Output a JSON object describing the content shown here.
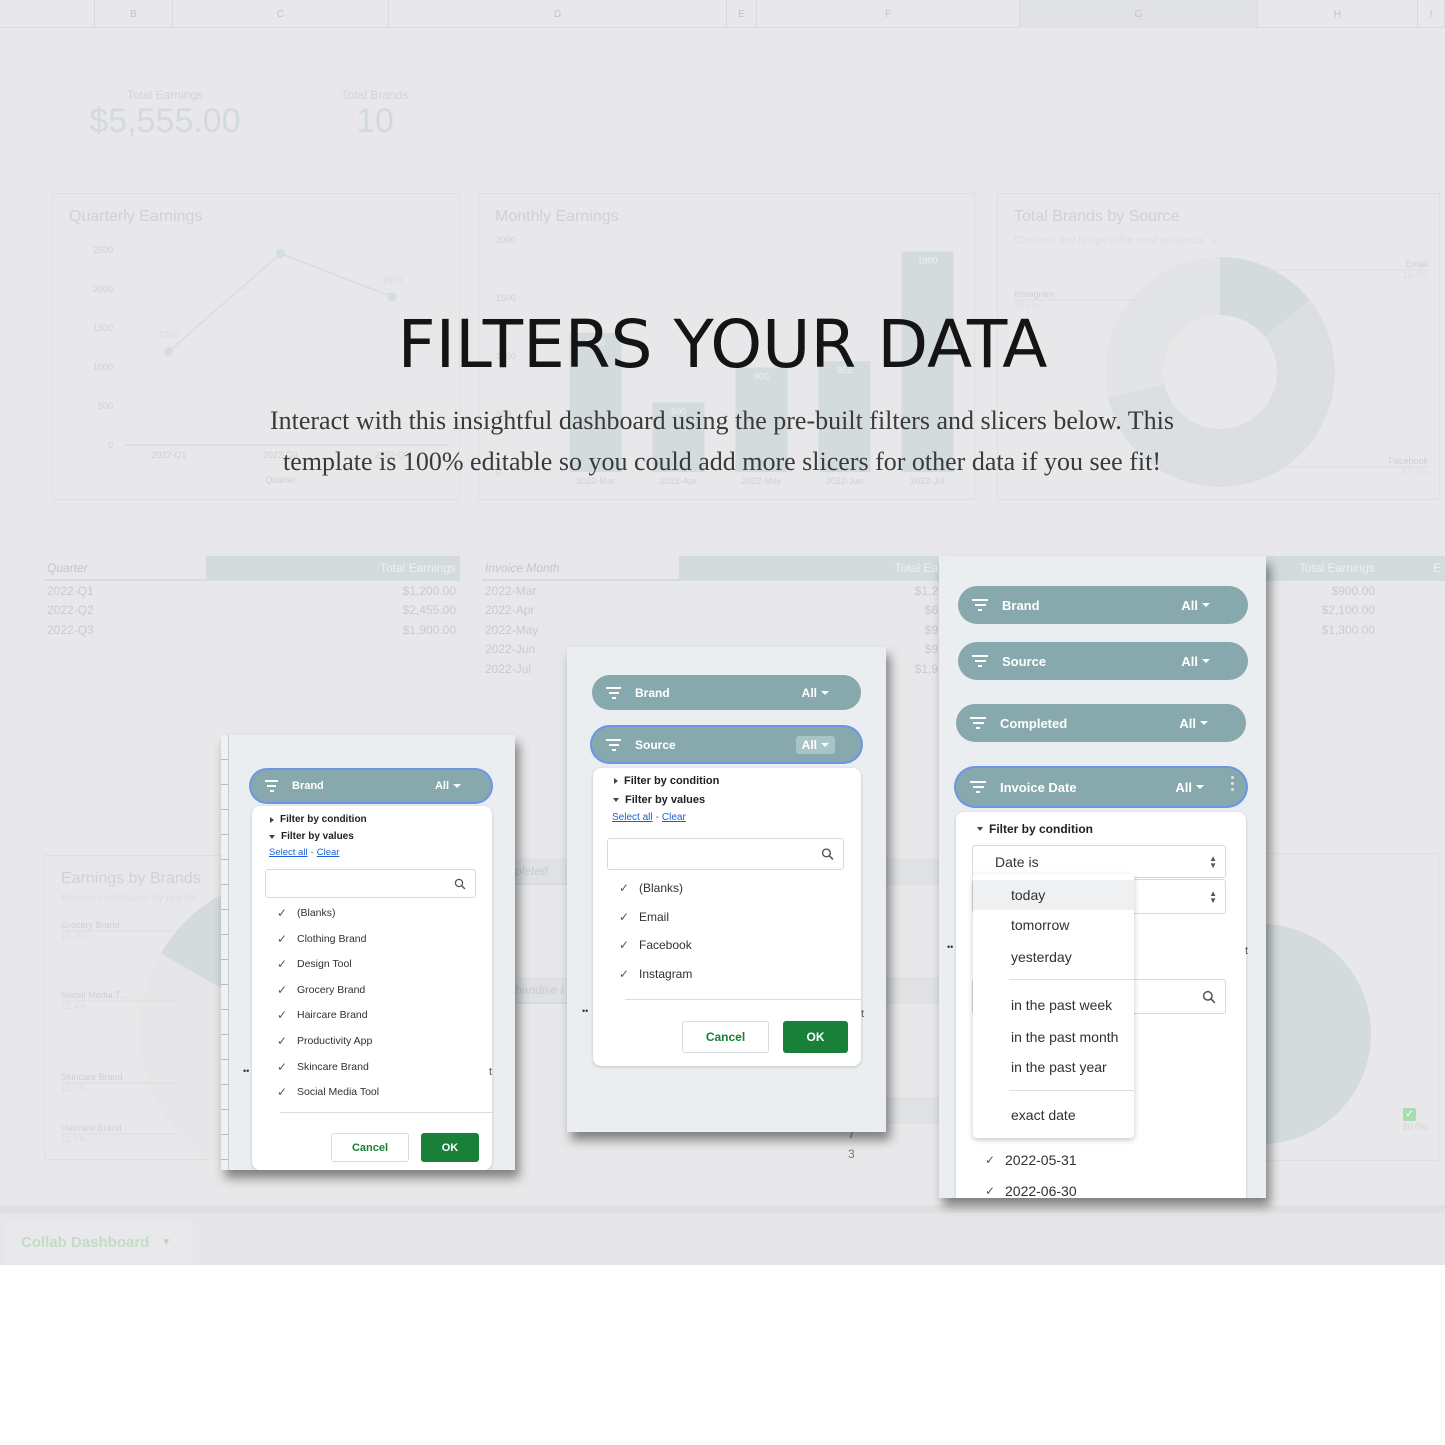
{
  "headline": "FILTERS YOUR DATA",
  "intro": "Interact with this insightful dashboard using the pre-built filters and slicers below. This template is 100% editable so you could add more slicers for other data if you see fit!",
  "background_sheet": {
    "columns": [
      "",
      "B",
      "C",
      "D",
      "E",
      "F",
      "G",
      "H",
      "I"
    ],
    "kpis": [
      {
        "label": "Total Earnings",
        "value": "$5,555.00"
      },
      {
        "label": "Total Brands",
        "value": "10"
      }
    ],
    "tab_label": "Collab Dashboard",
    "tables": {
      "quarterly": {
        "headers": [
          "Quarter",
          "Total Earnings"
        ],
        "rows": [
          [
            "2022-Q1",
            "$1,200.00"
          ],
          [
            "2022-Q2",
            "$2,455.00"
          ],
          [
            "2022-Q3",
            "$1,900.00"
          ]
        ]
      },
      "monthly": {
        "headers": [
          "Invoice Month",
          "Total Ea"
        ],
        "rows": [
          [
            "2022-Mar",
            "$1,2"
          ],
          [
            "2022-Apr",
            "$6"
          ],
          [
            "2022-May",
            "$9"
          ],
          [
            "2022-Jun",
            "$9"
          ],
          [
            "2022-Jul",
            "$1,9"
          ]
        ]
      },
      "right": {
        "headers": [
          "Total Earnings",
          "E"
        ],
        "rows": [
          [
            "$900.00"
          ],
          [
            "$2,100.00"
          ],
          [
            "$1,300.00"
          ]
        ]
      }
    },
    "fragments": {
      "completed": "pleted",
      "merchandise": "handise I",
      "small_num_1": "7",
      "small_num_2": "3",
      "pct_80": "80.0%"
    }
  },
  "chart_data": [
    {
      "type": "line",
      "title": "Quarterly Earnings",
      "xlabel": "Quarter",
      "ylabel": "",
      "categories": [
        "2022-Q1",
        "2022-Q2",
        "2022-Q3"
      ],
      "values": [
        1200,
        2455,
        1900
      ],
      "data_labels": [
        "1200",
        "",
        "1900"
      ],
      "yticks": [
        0,
        500,
        1000,
        1500,
        2000,
        2500
      ],
      "ylim": [
        0,
        2500
      ],
      "grid": true
    },
    {
      "type": "bar",
      "title": "Monthly Earnings",
      "categories": [
        "2022-Mar",
        "2022-Apr",
        "2022-May",
        "2022-Jun",
        "2022-Jul"
      ],
      "values": [
        1200,
        600,
        900,
        955,
        1900
      ],
      "data_labels": [
        "1200",
        "600",
        "900",
        "955",
        "1900"
      ],
      "yticks": [
        0,
        500,
        1000,
        1500,
        2000
      ],
      "ylim": [
        0,
        2000
      ],
      "grid": true
    },
    {
      "type": "pie",
      "title": "Total Brands by Source",
      "subtitle": "Channels that brings in the most prospects ⤵",
      "donut": true,
      "slices": [
        {
          "label": "Email",
          "value": 14.3,
          "display": "14.3%"
        },
        {
          "label": "Facebook",
          "value": 57.1,
          "display": "57.1%"
        },
        {
          "label": "Instagram",
          "value": 28.6,
          "display": "28.6%"
        }
      ]
    },
    {
      "type": "pie",
      "title": "Earnings by Brands",
      "subtitle": "Earning contribution by brands",
      "donut": true,
      "slices": [
        {
          "label": "Grocery Brand",
          "value": 14.3,
          "display": "14.3%"
        },
        {
          "label": "Social Media T...",
          "value": 12.4,
          "display": "12.4%"
        },
        {
          "label": "Skincare Brand",
          "value": 11.7,
          "display": "11.7%"
        },
        {
          "label": "Haircare Brand",
          "value": 11.7,
          "display": "11.7%"
        }
      ]
    }
  ],
  "panels": {
    "brand_panel": {
      "slicer": {
        "label": "Brand",
        "value": "All"
      },
      "filter_by_condition": "Filter by condition",
      "filter_by_values": "Filter by values",
      "select_all": "Select all",
      "clear": "Clear",
      "search_placeholder": "",
      "values": [
        "(Blanks)",
        "Clothing Brand",
        "Design Tool",
        "Grocery Brand",
        "Haircare Brand",
        "Productivity App",
        "Skincare Brand",
        "Social Media Tool"
      ],
      "cancel": "Cancel",
      "ok": "OK"
    },
    "source_panel": {
      "slicers": [
        {
          "label": "Brand",
          "value": "All"
        },
        {
          "label": "Source",
          "value": "All"
        }
      ],
      "filter_by_condition": "Filter by condition",
      "filter_by_values": "Filter by values",
      "select_all": "Select all",
      "clear": "Clear",
      "search_placeholder": "",
      "values": [
        "(Blanks)",
        "Email",
        "Facebook",
        "Instagram"
      ],
      "cancel": "Cancel",
      "ok": "OK"
    },
    "date_panel": {
      "slicers": [
        {
          "label": "Brand",
          "value": "All"
        },
        {
          "label": "Source",
          "value": "All"
        },
        {
          "label": "Completed",
          "value": "All"
        },
        {
          "label": "Invoice Date",
          "value": "All"
        }
      ],
      "filter_by_condition": "Filter by condition",
      "condition_select": "Date is",
      "condition_options": [
        "today",
        "tomorrow",
        "yesterday",
        "in the past week",
        "in the past month",
        "in the past year",
        "exact date"
      ],
      "highlighted_option": "today",
      "date_values": [
        "2022-05-31",
        "2022-06-30"
      ]
    }
  }
}
